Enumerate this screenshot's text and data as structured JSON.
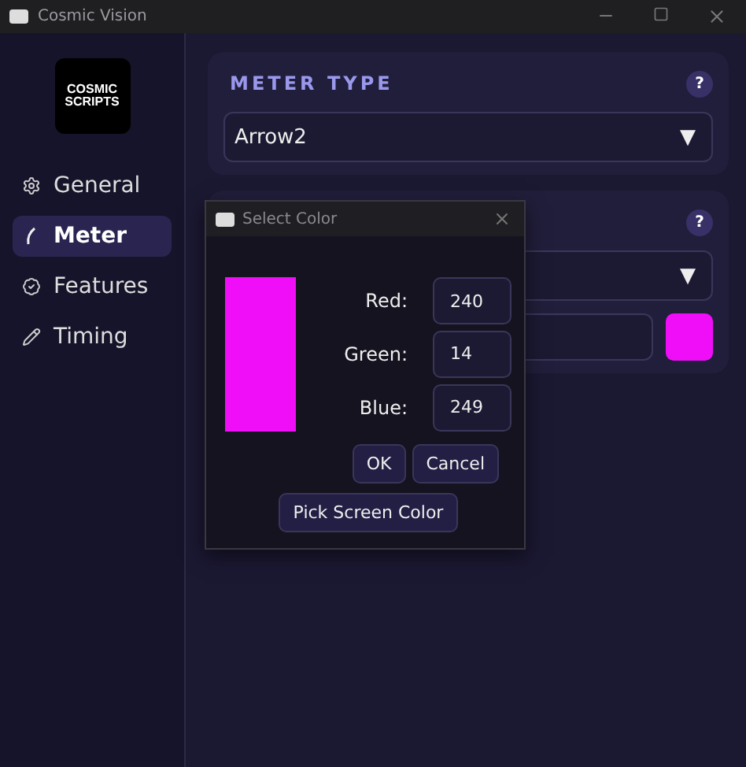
{
  "window": {
    "title": "Cosmic Vision"
  },
  "logo": {
    "line_1": "COSMIC",
    "line_2": "SCRIPTS"
  },
  "sidebar": {
    "items": [
      {
        "label": "General",
        "selected": false
      },
      {
        "label": "Meter",
        "selected": true
      },
      {
        "label": "Features",
        "selected": false
      },
      {
        "label": "Timing",
        "selected": false
      }
    ]
  },
  "meter_type_card": {
    "title": "METER TYPE",
    "help": "?",
    "dropdown": {
      "value": "Arrow2",
      "caret": "▼"
    }
  },
  "color_card": {
    "help": "?",
    "dropdown": {
      "caret": "▼"
    }
  },
  "dialog": {
    "title": "Select Color",
    "channels": [
      {
        "label": "Red:",
        "value": "240"
      },
      {
        "label": "Green:",
        "value": "14"
      },
      {
        "label": "Blue:",
        "value": "249"
      }
    ],
    "buttons": [
      "OK",
      "Cancel"
    ],
    "pick_button": "Pick Screen Color"
  }
}
